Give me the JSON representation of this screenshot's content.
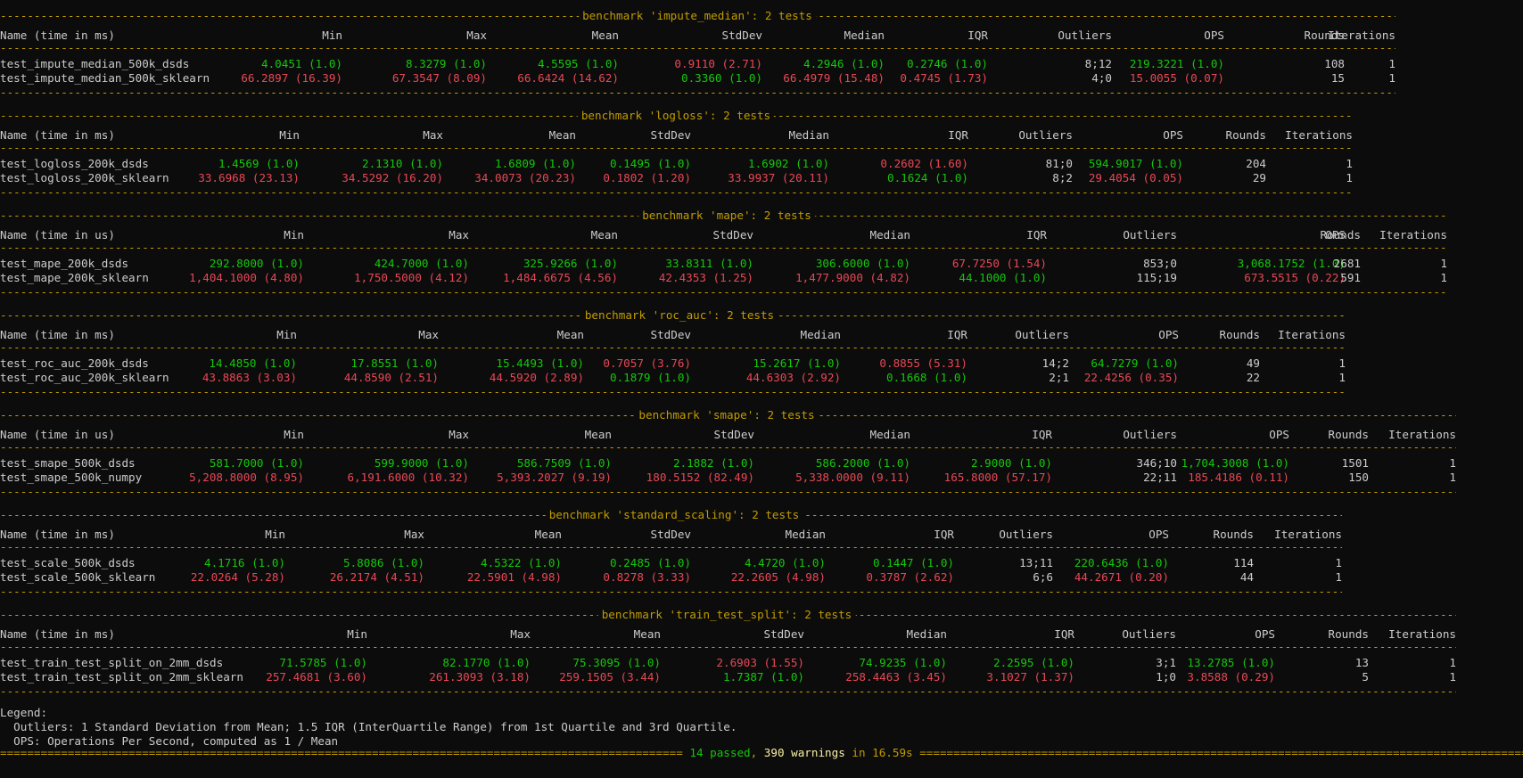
{
  "colors": {
    "background": "#0c0c0c",
    "rule": "#c19c00",
    "good": "#16c60c",
    "bad": "#e74856",
    "text": "#cccccc",
    "warn": "#f9f1a5"
  },
  "columns": [
    "Min",
    "Max",
    "Mean",
    "StdDev",
    "Median",
    "IQR",
    "Outliers",
    "OPS",
    "Rounds",
    "Iterations"
  ],
  "benchmarks": [
    {
      "title": "benchmark 'impute_median': 2 tests",
      "header": "Name (time in ms)",
      "rows": [
        {
          "name": "test_impute_median_500k_dsds",
          "cells": [
            [
              "4.0451 (1.0)",
              "g"
            ],
            [
              "8.3279 (1.0)",
              "g"
            ],
            [
              "4.5595 (1.0)",
              "g"
            ],
            [
              "0.9110 (2.71)",
              "r"
            ],
            [
              "4.2946 (1.0)",
              "g"
            ],
            [
              "0.2746 (1.0)",
              "g"
            ],
            [
              "8;12",
              "w"
            ],
            [
              "219.3221 (1.0)",
              "g"
            ],
            [
              "108",
              "w"
            ],
            [
              "1",
              "w"
            ]
          ]
        },
        {
          "name": "test_impute_median_500k_sklearn",
          "cells": [
            [
              "66.2897 (16.39)",
              "r"
            ],
            [
              "67.3547 (8.09)",
              "r"
            ],
            [
              "66.6424 (14.62)",
              "r"
            ],
            [
              "0.3360 (1.0)",
              "g"
            ],
            [
              "66.4979 (15.48)",
              "r"
            ],
            [
              "0.4745 (1.73)",
              "r"
            ],
            [
              "4;0",
              "w"
            ],
            [
              "15.0055 (0.07)",
              "r"
            ],
            [
              "15",
              "w"
            ],
            [
              "1",
              "w"
            ]
          ]
        }
      ]
    },
    {
      "title": "benchmark 'logloss': 2 tests",
      "header": "Name (time in ms)",
      "rows": [
        {
          "name": "test_logloss_200k_dsds",
          "cells": [
            [
              "1.4569 (1.0)",
              "g"
            ],
            [
              "2.1310 (1.0)",
              "g"
            ],
            [
              "1.6809 (1.0)",
              "g"
            ],
            [
              "0.1495 (1.0)",
              "g"
            ],
            [
              "1.6902 (1.0)",
              "g"
            ],
            [
              "0.2602 (1.60)",
              "r"
            ],
            [
              "81;0",
              "w"
            ],
            [
              "594.9017 (1.0)",
              "g"
            ],
            [
              "204",
              "w"
            ],
            [
              "1",
              "w"
            ]
          ]
        },
        {
          "name": "test_logloss_200k_sklearn",
          "cells": [
            [
              "33.6968 (23.13)",
              "r"
            ],
            [
              "34.5292 (16.20)",
              "r"
            ],
            [
              "34.0073 (20.23)",
              "r"
            ],
            [
              "0.1802 (1.20)",
              "r"
            ],
            [
              "33.9937 (20.11)",
              "r"
            ],
            [
              "0.1624 (1.0)",
              "g"
            ],
            [
              "8;2",
              "w"
            ],
            [
              "29.4054 (0.05)",
              "r"
            ],
            [
              "29",
              "w"
            ],
            [
              "1",
              "w"
            ]
          ]
        }
      ]
    },
    {
      "title": "benchmark 'mape': 2 tests",
      "header": "Name (time in us)",
      "rows": [
        {
          "name": "test_mape_200k_dsds",
          "cells": [
            [
              "292.8000 (1.0)",
              "g"
            ],
            [
              "424.7000 (1.0)",
              "g"
            ],
            [
              "325.9266 (1.0)",
              "g"
            ],
            [
              "33.8311 (1.0)",
              "g"
            ],
            [
              "306.6000 (1.0)",
              "g"
            ],
            [
              "67.7250 (1.54)",
              "r"
            ],
            [
              "853;0",
              "w"
            ],
            [
              "3,068.1752 (1.0)",
              "g"
            ],
            [
              "2681",
              "w"
            ],
            [
              "1",
              "w"
            ]
          ]
        },
        {
          "name": "test_mape_200k_sklearn",
          "cells": [
            [
              "1,404.1000 (4.80)",
              "r"
            ],
            [
              "1,750.5000 (4.12)",
              "r"
            ],
            [
              "1,484.6675 (4.56)",
              "r"
            ],
            [
              "42.4353 (1.25)",
              "r"
            ],
            [
              "1,477.9000 (4.82)",
              "r"
            ],
            [
              "44.1000 (1.0)",
              "g"
            ],
            [
              "115;19",
              "w"
            ],
            [
              "673.5515 (0.22)",
              "r"
            ],
            [
              "591",
              "w"
            ],
            [
              "1",
              "w"
            ]
          ]
        }
      ]
    },
    {
      "title": "benchmark 'roc_auc': 2 tests",
      "header": "Name (time in ms)",
      "rows": [
        {
          "name": "test_roc_auc_200k_dsds",
          "cells": [
            [
              "14.4850 (1.0)",
              "g"
            ],
            [
              "17.8551 (1.0)",
              "g"
            ],
            [
              "15.4493 (1.0)",
              "g"
            ],
            [
              "0.7057 (3.76)",
              "r"
            ],
            [
              "15.2617 (1.0)",
              "g"
            ],
            [
              "0.8855 (5.31)",
              "r"
            ],
            [
              "14;2",
              "w"
            ],
            [
              "64.7279 (1.0)",
              "g"
            ],
            [
              "49",
              "w"
            ],
            [
              "1",
              "w"
            ]
          ]
        },
        {
          "name": "test_roc_auc_200k_sklearn",
          "cells": [
            [
              "43.8863 (3.03)",
              "r"
            ],
            [
              "44.8590 (2.51)",
              "r"
            ],
            [
              "44.5920 (2.89)",
              "r"
            ],
            [
              "0.1879 (1.0)",
              "g"
            ],
            [
              "44.6303 (2.92)",
              "r"
            ],
            [
              "0.1668 (1.0)",
              "g"
            ],
            [
              "2;1",
              "w"
            ],
            [
              "22.4256 (0.35)",
              "r"
            ],
            [
              "22",
              "w"
            ],
            [
              "1",
              "w"
            ]
          ]
        }
      ]
    },
    {
      "title": "benchmark 'smape': 2 tests",
      "header": "Name (time in us)",
      "rows": [
        {
          "name": "test_smape_500k_dsds",
          "cells": [
            [
              "581.7000 (1.0)",
              "g"
            ],
            [
              "599.9000 (1.0)",
              "g"
            ],
            [
              "586.7509 (1.0)",
              "g"
            ],
            [
              "2.1882 (1.0)",
              "g"
            ],
            [
              "586.2000 (1.0)",
              "g"
            ],
            [
              "2.9000 (1.0)",
              "g"
            ],
            [
              "346;10",
              "w"
            ],
            [
              "1,704.3008 (1.0)",
              "g"
            ],
            [
              "1501",
              "w"
            ],
            [
              "1",
              "w"
            ]
          ]
        },
        {
          "name": "test_smape_500k_numpy",
          "cells": [
            [
              "5,208.8000 (8.95)",
              "r"
            ],
            [
              "6,191.6000 (10.32)",
              "r"
            ],
            [
              "5,393.2027 (9.19)",
              "r"
            ],
            [
              "180.5152 (82.49)",
              "r"
            ],
            [
              "5,338.0000 (9.11)",
              "r"
            ],
            [
              "165.8000 (57.17)",
              "r"
            ],
            [
              "22;11",
              "w"
            ],
            [
              "185.4186 (0.11)",
              "r"
            ],
            [
              "150",
              "w"
            ],
            [
              "1",
              "w"
            ]
          ]
        }
      ]
    },
    {
      "title": "benchmark 'standard_scaling': 2 tests",
      "header": "Name (time in ms)",
      "rows": [
        {
          "name": "test_scale_500k_dsds",
          "cells": [
            [
              "4.1716 (1.0)",
              "g"
            ],
            [
              "5.8086 (1.0)",
              "g"
            ],
            [
              "4.5322 (1.0)",
              "g"
            ],
            [
              "0.2485 (1.0)",
              "g"
            ],
            [
              "4.4720 (1.0)",
              "g"
            ],
            [
              "0.1447 (1.0)",
              "g"
            ],
            [
              "13;11",
              "w"
            ],
            [
              "220.6436 (1.0)",
              "g"
            ],
            [
              "114",
              "w"
            ],
            [
              "1",
              "w"
            ]
          ]
        },
        {
          "name": "test_scale_500k_sklearn",
          "cells": [
            [
              "22.0264 (5.28)",
              "r"
            ],
            [
              "26.2174 (4.51)",
              "r"
            ],
            [
              "22.5901 (4.98)",
              "r"
            ],
            [
              "0.8278 (3.33)",
              "r"
            ],
            [
              "22.2605 (4.98)",
              "r"
            ],
            [
              "0.3787 (2.62)",
              "r"
            ],
            [
              "6;6",
              "w"
            ],
            [
              "44.2671 (0.20)",
              "r"
            ],
            [
              "44",
              "w"
            ],
            [
              "1",
              "w"
            ]
          ]
        }
      ]
    },
    {
      "title": "benchmark 'train_test_split': 2 tests",
      "header": "Name (time in ms)",
      "rows": [
        {
          "name": "test_train_test_split_on_2mm_dsds",
          "cells": [
            [
              "71.5785 (1.0)",
              "g"
            ],
            [
              "82.1770 (1.0)",
              "g"
            ],
            [
              "75.3095 (1.0)",
              "g"
            ],
            [
              "2.6903 (1.55)",
              "r"
            ],
            [
              "74.9235 (1.0)",
              "g"
            ],
            [
              "2.2595 (1.0)",
              "g"
            ],
            [
              "3;1",
              "w"
            ],
            [
              "13.2785 (1.0)",
              "g"
            ],
            [
              "13",
              "w"
            ],
            [
              "1",
              "w"
            ]
          ]
        },
        {
          "name": "test_train_test_split_on_2mm_sklearn",
          "cells": [
            [
              "257.4681 (3.60)",
              "r"
            ],
            [
              "261.3093 (3.18)",
              "r"
            ],
            [
              "259.1505 (3.44)",
              "r"
            ],
            [
              "1.7387 (1.0)",
              "g"
            ],
            [
              "258.4463 (3.45)",
              "r"
            ],
            [
              "3.1027 (1.37)",
              "r"
            ],
            [
              "1;0",
              "w"
            ],
            [
              "3.8588 (0.29)",
              "r"
            ],
            [
              "5",
              "w"
            ],
            [
              "1",
              "w"
            ]
          ]
        }
      ]
    }
  ],
  "legend": {
    "title": "Legend:",
    "lines": [
      "  Outliers: 1 Standard Deviation from Mean; 1.5 IQR (InterQuartile Range) from 1st Quartile and 3rd Quartile.",
      "  OPS: Operations Per Second, computed as 1 / Mean"
    ]
  },
  "summary": {
    "passed": "14 passed",
    "sep": ", ",
    "warnings": "390 warnings",
    "time": " in 16.59s "
  }
}
